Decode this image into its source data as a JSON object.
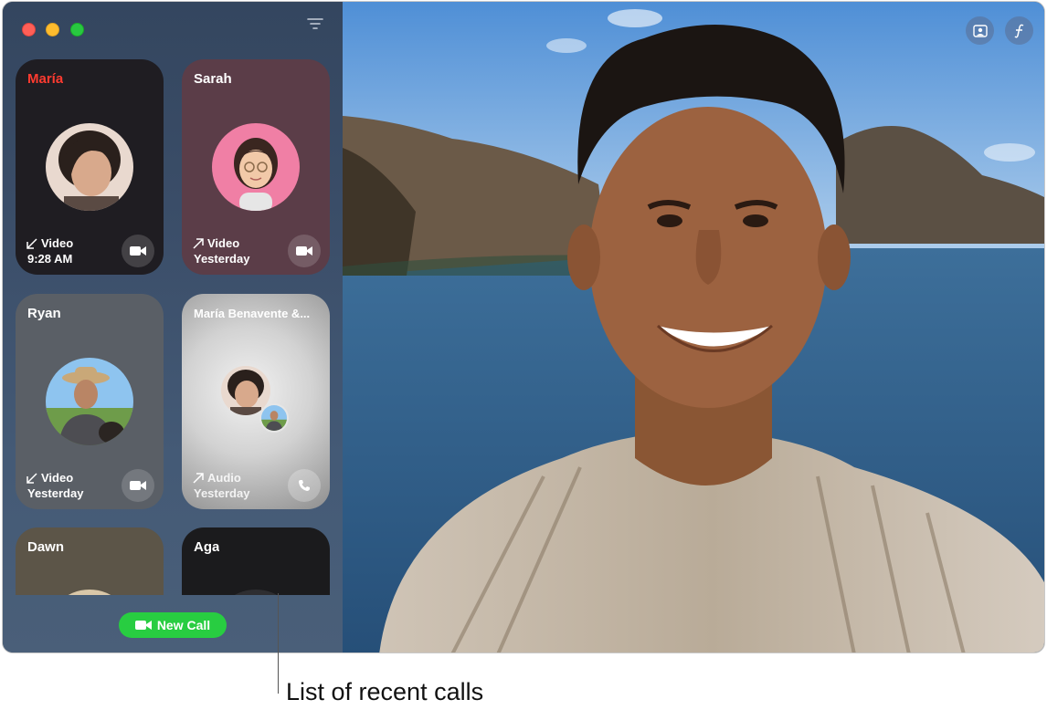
{
  "sidebar": {
    "cards": [
      {
        "name": "María",
        "call_type": "Video",
        "direction": "incoming",
        "time": "9:28 AM",
        "action": "video"
      },
      {
        "name": "Sarah",
        "call_type": "Video",
        "direction": "outgoing",
        "time": "Yesterday",
        "action": "video"
      },
      {
        "name": "Ryan",
        "call_type": "Video",
        "direction": "incoming",
        "time": "Yesterday",
        "action": "video"
      },
      {
        "name": "María Benavente &...",
        "call_type": "Audio",
        "direction": "outgoing",
        "time": "Yesterday",
        "action": "phone"
      },
      {
        "name": "Dawn"
      },
      {
        "name": "Aga"
      }
    ],
    "new_call_label": "New Call"
  },
  "callout": {
    "label": "List of recent calls"
  },
  "colors": {
    "accent_green": "#28cd41",
    "missed_red": "#ff3b30"
  },
  "icons": [
    "filter-icon",
    "video-camera-icon",
    "phone-icon",
    "incoming-arrow-icon",
    "outgoing-arrow-icon",
    "people-icon",
    "effects-icon"
  ]
}
